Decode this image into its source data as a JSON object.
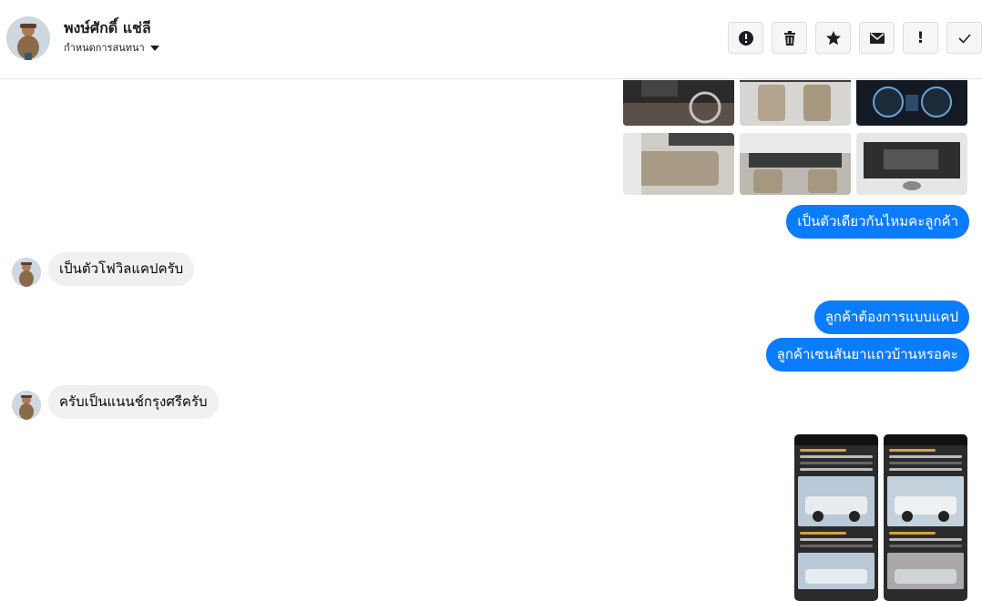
{
  "header": {
    "contact_name": "พงษ์ศักดิ์ แช่ลี",
    "conversation_settings_label": "กำหนดการสนทนา",
    "toolbar_icons": [
      "alert-circle-icon",
      "trash-icon",
      "star-icon",
      "envelope-icon",
      "exclamation-icon",
      "check-icon"
    ],
    "exclamation_glyph": "!"
  },
  "messages": [
    {
      "direction": "outgoing",
      "type": "photo-grid",
      "count": 6
    },
    {
      "direction": "outgoing",
      "type": "text",
      "text": "เป็นตัวเดียวกันไหมคะลูกค้า"
    },
    {
      "direction": "incoming",
      "type": "text",
      "text": "เป็นตัวโฟวิลแคปครับ"
    },
    {
      "direction": "outgoing",
      "type": "text",
      "text": "ลูกค้าต้องการแบบแคป"
    },
    {
      "direction": "outgoing",
      "type": "text",
      "text": "ลูกค้าเซนสันยาแถวบ้านหรอคะ"
    },
    {
      "direction": "incoming",
      "type": "text",
      "text": "ครับเป็นแนนช์กรุงศรีครับ"
    },
    {
      "direction": "outgoing",
      "type": "screenshots",
      "count": 2
    }
  ],
  "colors": {
    "outgoing_bubble": "#0a7cff",
    "incoming_bubble": "#f0f0f0"
  }
}
